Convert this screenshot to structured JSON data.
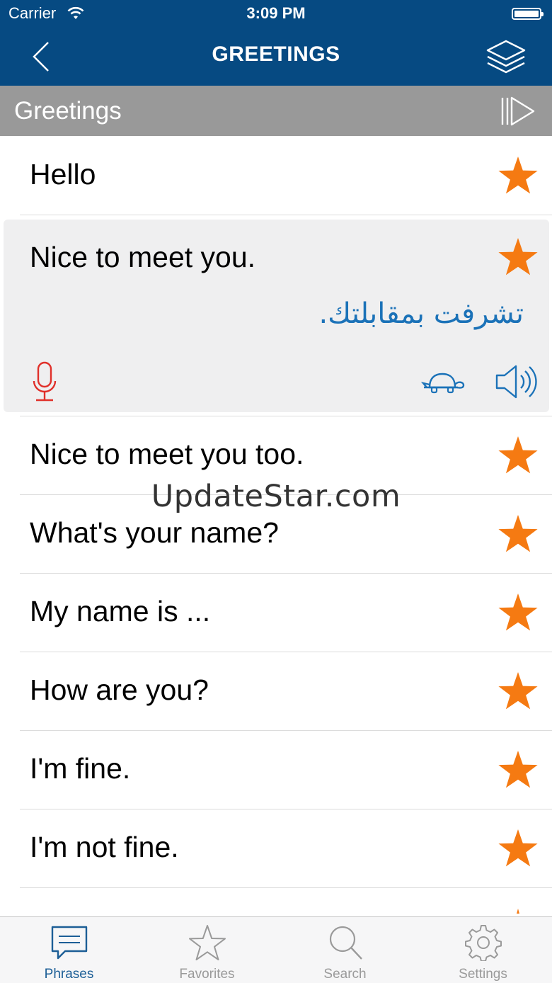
{
  "status_bar": {
    "carrier": "Carrier",
    "time": "3:09 PM"
  },
  "nav": {
    "title": "GREETINGS"
  },
  "section": {
    "title": "Greetings"
  },
  "phrases": [
    {
      "text": "Hello",
      "favorite": true
    },
    {
      "text": "Nice to meet you.",
      "translation": "تشرفت بمقابلتك.",
      "favorite": true,
      "expanded": true
    },
    {
      "text": "Nice to meet you too.",
      "favorite": true
    },
    {
      "text": "What's your name?",
      "favorite": true
    },
    {
      "text": "My name is ...",
      "favorite": true
    },
    {
      "text": "How are you?",
      "favorite": true
    },
    {
      "text": "I'm fine.",
      "favorite": true
    },
    {
      "text": "I'm not fine.",
      "favorite": true
    }
  ],
  "watermark": "UpdateStar.com",
  "tabs": [
    {
      "label": "Phrases",
      "icon": "speech-bubble-icon",
      "active": true
    },
    {
      "label": "Favorites",
      "icon": "star-icon",
      "active": false
    },
    {
      "label": "Search",
      "icon": "search-icon",
      "active": false
    },
    {
      "label": "Settings",
      "icon": "gear-icon",
      "active": false
    }
  ],
  "colors": {
    "nav_bg": "#064a82",
    "section_bg": "#999999",
    "star": "#f57a12",
    "translation": "#1b72b8",
    "mic": "#e0302a",
    "tab_active": "#1c5e96"
  }
}
